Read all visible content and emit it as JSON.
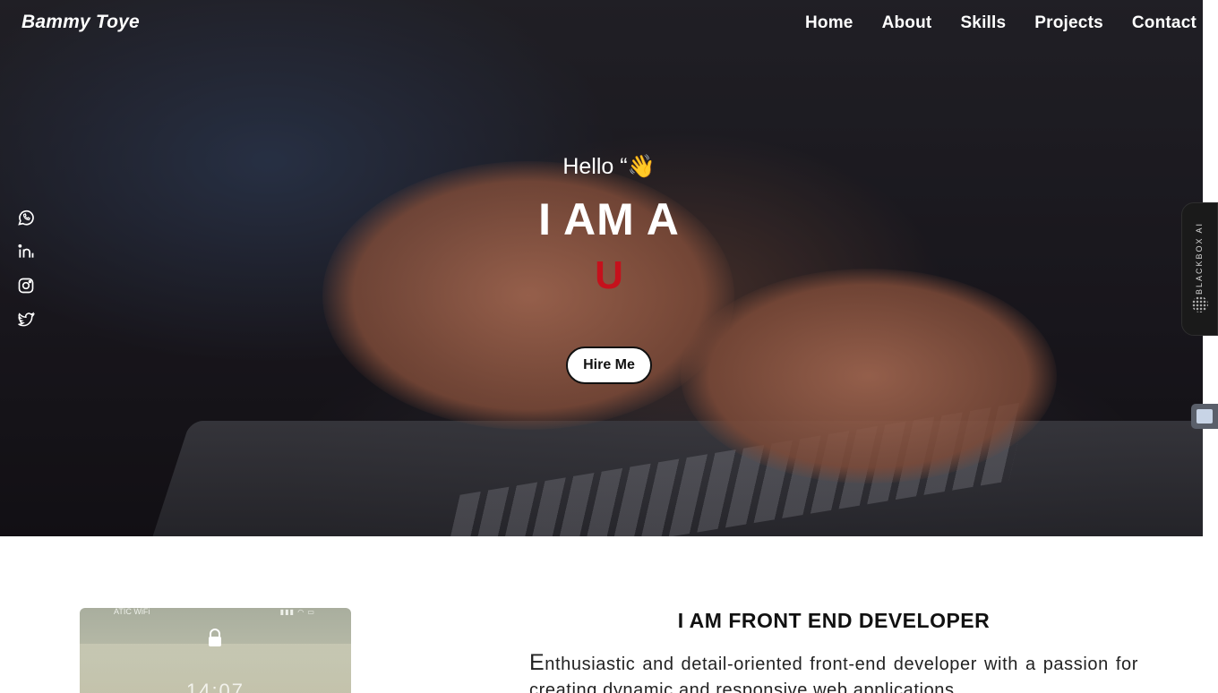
{
  "header": {
    "brand": "Bammy Toye",
    "nav": [
      "Home",
      "About",
      "Skills",
      "Projects",
      "Contact"
    ]
  },
  "social": {
    "icons": [
      "whatsapp-icon",
      "linkedin-icon",
      "instagram-icon",
      "twitter-icon"
    ]
  },
  "hero": {
    "greeting": "Hello “👋",
    "headline": "I AM A",
    "typed_text": "U",
    "cta_label": "Hire Me",
    "typed_color": "#c5111c"
  },
  "widget": {
    "label": "BLACKBOX AI"
  },
  "phone": {
    "carrier": "ATIC WiFi",
    "time": "14:07"
  },
  "about": {
    "title": "I AM FRONT END DEVELOPER",
    "first_letter": "E",
    "text": "nthusiastic and detail-oriented front-end developer with a passion for creating dynamic and responsive web applications."
  }
}
